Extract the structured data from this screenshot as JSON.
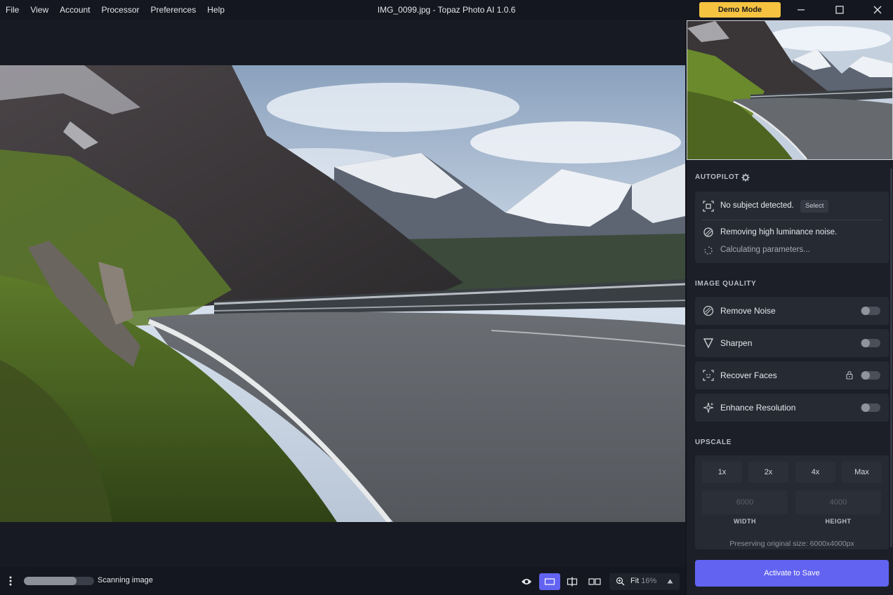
{
  "titlebar": {
    "menu": [
      "File",
      "View",
      "Account",
      "Processor",
      "Preferences",
      "Help"
    ],
    "window_title": "IMG_0099.jpg - Topaz Photo AI 1.0.6",
    "demo_mode": "Demo Mode"
  },
  "autopilot": {
    "title": "AUTOPILOT",
    "subject": "No subject detected.",
    "select": "Select",
    "noise_status": "Removing high luminance noise.",
    "calc_status": "Calculating parameters..."
  },
  "image_quality": {
    "title": "IMAGE QUALITY",
    "items": [
      {
        "label": "Remove Noise",
        "enabled": false
      },
      {
        "label": "Sharpen",
        "enabled": false
      },
      {
        "label": "Recover Faces",
        "enabled": false,
        "locked": true
      },
      {
        "label": "Enhance Resolution",
        "enabled": false
      }
    ]
  },
  "upscale": {
    "title": "UPSCALE",
    "options": [
      "1x",
      "2x",
      "4x",
      "Max"
    ],
    "width_placeholder": "6000",
    "height_placeholder": "4000",
    "width_label": "WIDTH",
    "height_label": "HEIGHT",
    "preserving": "Preserving original size: 6000x4000px"
  },
  "activate": "Activate to Save",
  "status": {
    "scan_text": "Scanning image",
    "progress": 0.75
  },
  "zoom": {
    "label": "Fit",
    "percent": "16%"
  },
  "colors": {
    "accent": "#6363f2",
    "demo": "#f6c341",
    "background": "#171a22",
    "panel": "#1c1f27"
  }
}
